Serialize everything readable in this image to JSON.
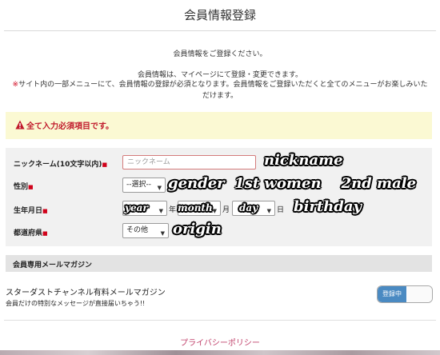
{
  "page": {
    "title": "会員情報登録",
    "intro_line1": "会員情報をご登録ください。",
    "intro_line2": "会員情報は、マイページにて登録・変更できます。",
    "intro_mark": "※",
    "intro_line3": "サイト内の一部メニューにて、会員情報の登録が必須となります。会員情報をご登録いただくと全てのメニューがお楽しみいただけます。"
  },
  "alert": {
    "text": "全て入力必須項目です。",
    "color": "#c0192b",
    "icon": "warning-icon"
  },
  "form": {
    "nickname_label": "ニックネーム(10文字以内)",
    "nickname_placeholder": "ニックネーム",
    "gender_label": "性別",
    "gender_value": "--選択--",
    "birthday_label": "生年月日",
    "year_unit": "年",
    "month_unit": "月",
    "day_unit": "日",
    "prefecture_label": "都道府県",
    "prefecture_value": "その他",
    "required_mark": "■"
  },
  "annotations": {
    "nickname": "nickname",
    "gender": "gender  1st women    2nd male",
    "year": "year",
    "month": "month",
    "day": "day",
    "birthday": "birthday",
    "origin": "origin"
  },
  "newsletter": {
    "section_title": "会員専用メールマガジン",
    "title": "スターダストチャンネル有料メールマガジン",
    "description": "会員だけの特別なメッセージが直接届いちゃう!!",
    "toggle_label": "登録中",
    "toggle_on": true,
    "toggle_color": "#4a8ac2"
  },
  "footer": {
    "privacy_link": "プライバシーポリシー"
  }
}
